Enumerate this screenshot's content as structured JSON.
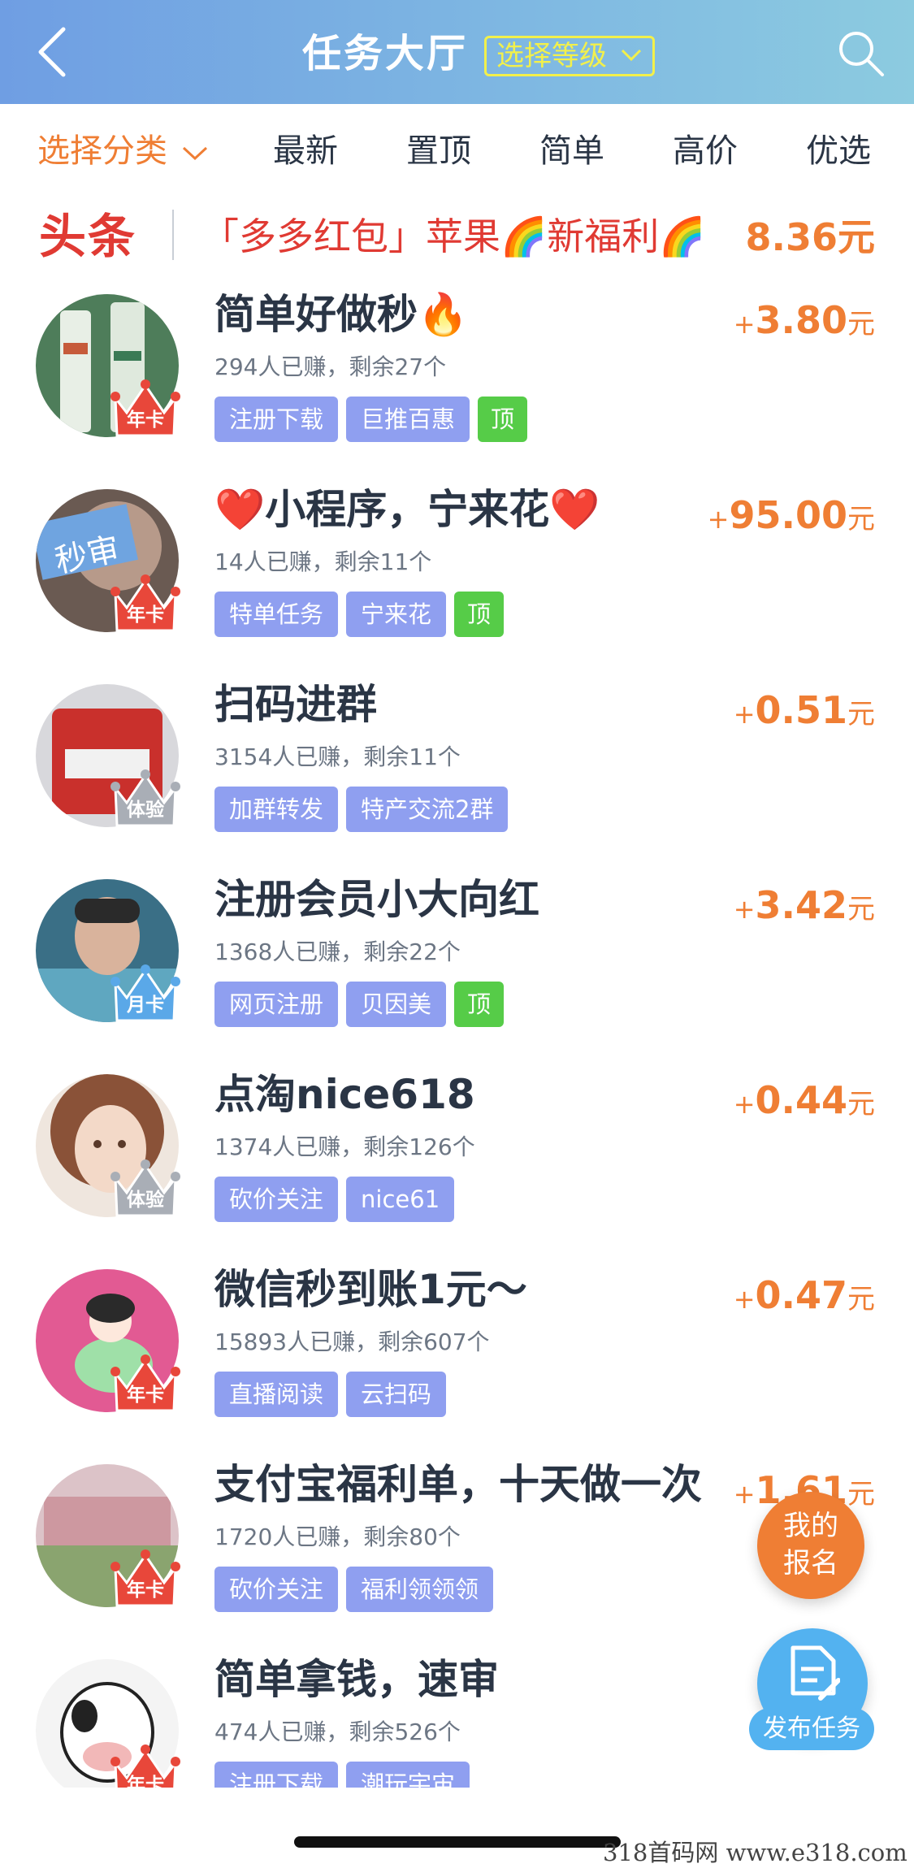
{
  "header": {
    "title": "任务大厅",
    "level_label": "选择等级"
  },
  "filters": {
    "category_label": "选择分类",
    "items": [
      "最新",
      "置顶",
      "简单",
      "高价",
      "优选"
    ]
  },
  "headline": {
    "tag": "头条",
    "text": "「多多红包」苹果🌈新福利🌈",
    "price": "8.36元"
  },
  "tasks": [
    {
      "title": "简单好做秒🔥",
      "stats": "294人已赚，剩余27个",
      "price": "3.80",
      "badge": "年卡",
      "tags": [
        "注册下载",
        "巨推百惠",
        "顶"
      ]
    },
    {
      "title": "❤️小程序，宁来花❤️",
      "stats": "14人已赚，剩余11个",
      "price": "95.00",
      "badge": "年卡",
      "tags": [
        "特单任务",
        "宁来花",
        "顶"
      ]
    },
    {
      "title": "扫码进群",
      "stats": "3154人已赚，剩余11个",
      "price": "0.51",
      "badge": "体验",
      "tags": [
        "加群转发",
        "特产交流2群"
      ]
    },
    {
      "title": "注册会员小大向红",
      "stats": "1368人已赚，剩余22个",
      "price": "3.42",
      "badge": "月卡",
      "tags": [
        "网页注册",
        "贝因美",
        "顶"
      ]
    },
    {
      "title": "点淘nice618",
      "stats": "1374人已赚，剩余126个",
      "price": "0.44",
      "badge": "体验",
      "tags": [
        "砍价关注",
        "nice61"
      ]
    },
    {
      "title": "微信秒到账1元～",
      "stats": "15893人已赚，剩余607个",
      "price": "0.47",
      "badge": "年卡",
      "tags": [
        "直播阅读",
        "云扫码"
      ]
    },
    {
      "title": "支付宝福利单，十天做一次",
      "stats": "1720人已赚，剩余80个",
      "price": "1.61",
      "badge": "年卡",
      "tags": [
        "砍价关注",
        "福利领领领"
      ]
    },
    {
      "title": "简单拿钱，速审",
      "stats": "474人已赚，剩余526个",
      "price": "",
      "badge": "年卡",
      "tags": [
        "注册下载",
        "潮玩宇宙"
      ]
    }
  ],
  "price_plus": "+",
  "price_unit": "元",
  "fab": {
    "signup_line1": "我的",
    "signup_line2": "报名",
    "publish_label": "发布任务"
  },
  "watermark": "318首码网  www.e318.com",
  "colors": {
    "accent_orange": "#ef7e34",
    "headline_red": "#e03a33",
    "tag_purple": "#8f9ff0",
    "tag_green": "#56cc48",
    "header_blue": "#6f9ee3",
    "fab_blue": "#53b2f0"
  }
}
